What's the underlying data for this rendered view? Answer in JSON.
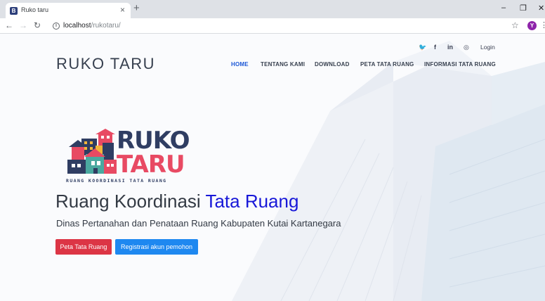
{
  "browser": {
    "tab_title": "Ruko taru",
    "tab_favicon": "B",
    "tab_close": "×",
    "new_tab": "+",
    "url_host": "localhost",
    "url_path": "/rukotaru/",
    "profile_initial": "Y",
    "icons": [
      "back-icon",
      "forward-icon",
      "reload-icon",
      "info-icon",
      "star-icon",
      "minimize-icon",
      "maximize-icon",
      "close-icon",
      "menu-icon"
    ]
  },
  "site": {
    "brand": "RUKO TARU",
    "social": {
      "twitter": "🐦",
      "facebook": "f",
      "linkedin": "in",
      "instagram": "◎"
    },
    "login": "Login",
    "menu": [
      "HOME",
      "TENTANG KAMI",
      "DOWNLOAD",
      "PETA TATA RUANG",
      "INFORMASI TATA RUANG"
    ],
    "active_menu": "HOME"
  },
  "hero": {
    "logo_line1": "RUKO",
    "logo_line2": "TARU",
    "logo_tagline": "RUANG KOORDINASI TATA RUANG",
    "title_main": "Ruang Koordinasi ",
    "title_accent": "Tata Ruang",
    "subtitle": "Dinas Pertanahan dan Penataan Ruang Kabupaten Kutai Kartanegara",
    "button_primary": "Peta Tata Ruang",
    "button_secondary": "Registrasi akun pemohon"
  },
  "colors": {
    "logo_navy": "#2f3d62",
    "logo_pink": "#e84a63",
    "accent_blue": "#1818d8",
    "button_red": "#dc3545",
    "button_blue": "#1e88f0"
  }
}
